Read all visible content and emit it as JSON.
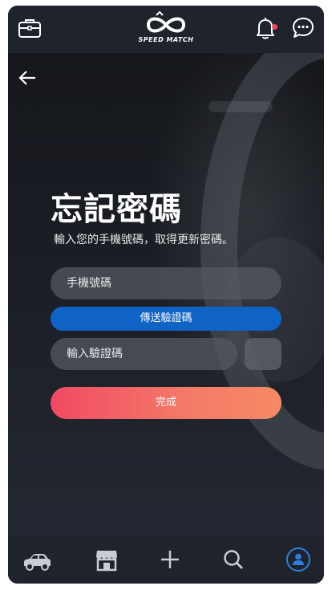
{
  "header": {
    "logo_text": "SPEED MATCH",
    "icons": [
      "briefcase-icon",
      "bell-icon",
      "chat-icon"
    ],
    "notification_dot_color": "#f0485a"
  },
  "page": {
    "title": "忘記密碼",
    "subtitle": "輸入您的手機號碼，取得更新密碼。"
  },
  "form": {
    "phone_placeholder": "手機號碼",
    "send_code_label": "傳送驗證碼",
    "code_placeholder": "輸入驗證碼",
    "submit_label": "完成"
  },
  "colors": {
    "send_button": "#0f63c4",
    "submit_gradient_start": "#f14a63",
    "submit_gradient_end": "#f68a66",
    "active_nav": "#2b7fe0"
  },
  "bottom_nav": {
    "items": [
      "car-icon",
      "store-icon",
      "plus-icon",
      "search-icon",
      "profile-icon"
    ],
    "active": "profile-icon"
  }
}
